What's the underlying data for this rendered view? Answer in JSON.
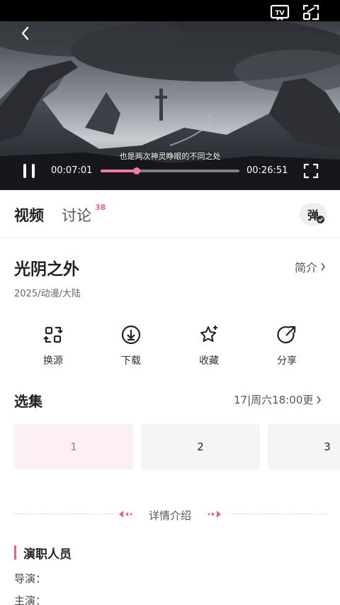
{
  "player": {
    "subtitle": "也是两次神灵睁眼的不同之处",
    "current_time": "00:07:01",
    "total_time": "00:26:51",
    "progress": 0.26,
    "accent": "#f07aa8"
  },
  "tabs": [
    {
      "label": "视频",
      "active": true
    },
    {
      "label": "讨论",
      "badge": "38",
      "active": false
    }
  ],
  "danmu_label": "弹",
  "show": {
    "title": "光阴之外",
    "intro_label": "简介",
    "meta": "2025/动漫/大陆"
  },
  "actions": [
    {
      "label": "换源",
      "icon": "switch-source-icon"
    },
    {
      "label": "下载",
      "icon": "download-icon"
    },
    {
      "label": "收藏",
      "icon": "star-icon"
    },
    {
      "label": "分享",
      "icon": "share-icon"
    }
  ],
  "episodes": {
    "title": "选集",
    "update": "17|周六18:00更",
    "items": [
      "1",
      "2",
      "3"
    ],
    "active_index": 0
  },
  "detail": {
    "label": "详情介绍"
  },
  "cast": {
    "title": "演职人员",
    "director": "导演：",
    "actors": "主演："
  },
  "colors": {
    "accent": "#e9608f"
  }
}
